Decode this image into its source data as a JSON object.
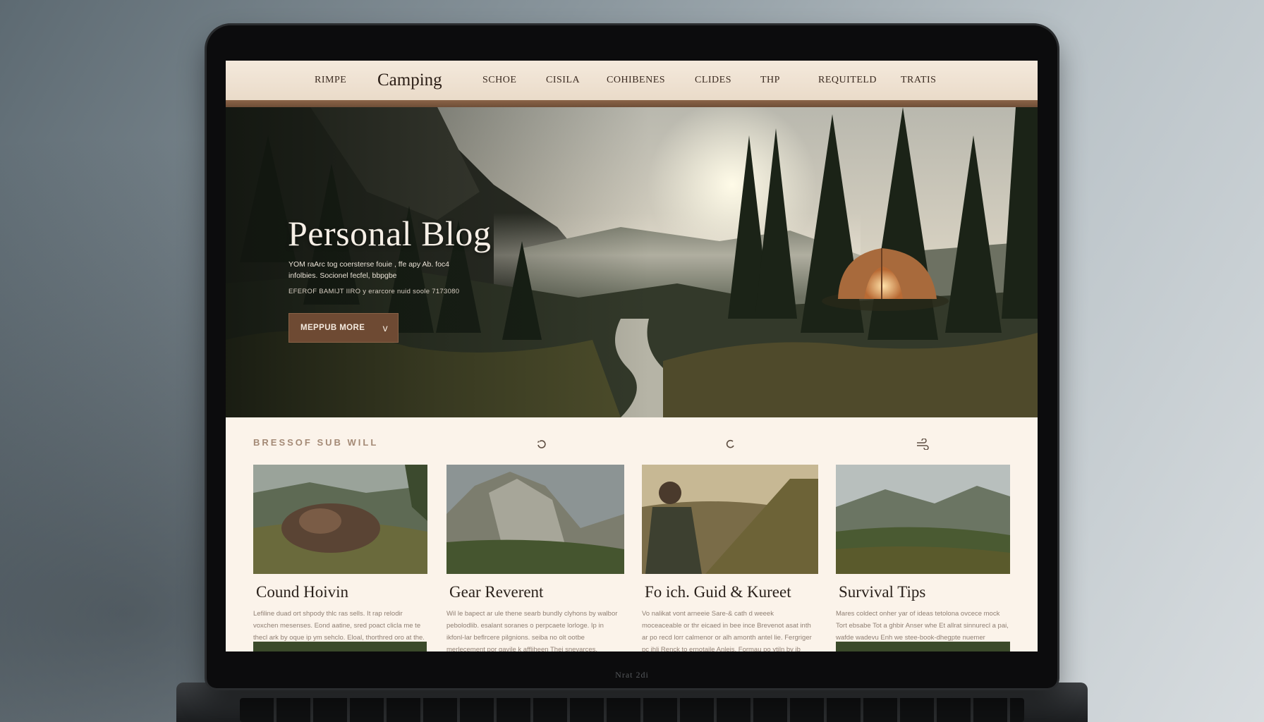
{
  "bezel": {
    "label": "Nrat 2di"
  },
  "nav": {
    "items": [
      "RIMPE",
      "SCHOE",
      "CISILA",
      "COHIBENES",
      "CLIDES",
      "THP",
      "REQUITELD",
      "TRATIS"
    ],
    "brand": "Camping"
  },
  "hero": {
    "title": "Personal Blog",
    "desc_line1": "YOM raArc tog coersterse fouie , ffe apy Ab. foc4",
    "desc_line2": "infolbies. Socionel fecfel, bbpgbe",
    "meta": "EFEROF BAMIJT IIRO y erarcore nuid soole 7173080",
    "button_label": "MEPPUB MORE",
    "button_chevron": "v"
  },
  "section": {
    "label": "BRESSOF SUB WILL",
    "icons": [
      "refresh-icon",
      "loop-icon",
      "wind-icon"
    ]
  },
  "cards": [
    {
      "title": "Cound Hoivin",
      "text": "Lefiline duad ort shpody thlc ras sells. It rap relodir voxchen mesenses. Eond aatine, sred poact clicla me te thecl ark by oque ip ym sehclo. Eloal, thorthred oro at the. Al als kmolns buil rlw Jortbe Aslo Brendgph"
    },
    {
      "title": "Gear Reverent",
      "text": "Wil le bapect ar ule thene searb bundly clyhons by walbor pebolodlib. esalant soranes o perpcaete lorloge. Ip in ikfonl-lar beflrcere pilgnions. seiba no olt ootbe merlecement por gavile k affliheen Thei snevarces. mbenb alolatt hnbon h me nsaimst aeuosle. are thvl omolh brtlealv."
    },
    {
      "title": "Fo ich. Guid & Kureet",
      "text": "Vo nalikat vont arneeie Sare-& cath d weeek moceaceable or thr eicaed in bee ince Brevenot asat inth ar po recd lorr calmenor or alh amonth antel lie. Fergriger pc ihli Renck to ernotaile Anleis. Formau po ytiln by ib mene."
    },
    {
      "title": "Survival Tips",
      "text": "Mares coldect onher yar of ideas tetolona ovcece mock Tort ebsabe Tot a ghbir Anser whe Et allrat sinnurecl a pai, wafde wadevu Enh we stee-book-dhegpte nuemer nomaslonuly a camy. Brathes dlluis."
    }
  ]
}
